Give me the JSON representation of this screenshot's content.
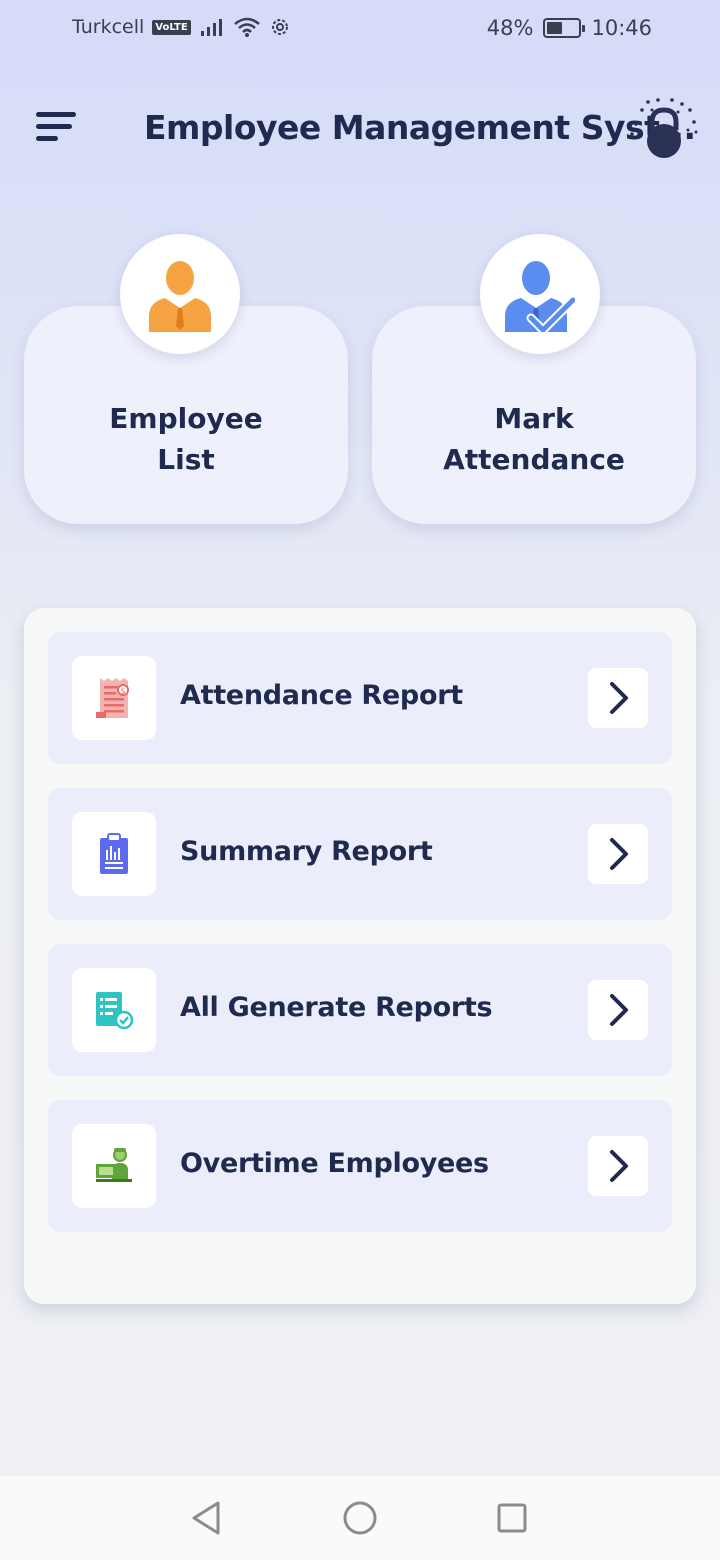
{
  "status_bar": {
    "carrier": "Turkcell",
    "volte": "VoLTE",
    "battery_percent": "48%",
    "battery_level": 0.48,
    "time": "10:46"
  },
  "app_bar": {
    "title": "Employee Management Syst..."
  },
  "tiles": [
    {
      "label": "Employee\nList",
      "icon": "employee-icon",
      "color": "#f6a443"
    },
    {
      "label": "Mark\nAttendance",
      "icon": "attendance-check-icon",
      "color": "#5b8df0"
    }
  ],
  "reports": [
    {
      "label": "Attendance Report",
      "icon": "invoice-receipt-icon",
      "color": "#e86a6a"
    },
    {
      "label": "Summary Report",
      "icon": "clipboard-chart-icon",
      "color": "#5d6af0"
    },
    {
      "label": "All Generate Reports",
      "icon": "document-check-icon",
      "color": "#2ec4c4"
    },
    {
      "label": "Overtime Employees",
      "icon": "worker-desk-icon",
      "color": "#5fa53a"
    }
  ]
}
